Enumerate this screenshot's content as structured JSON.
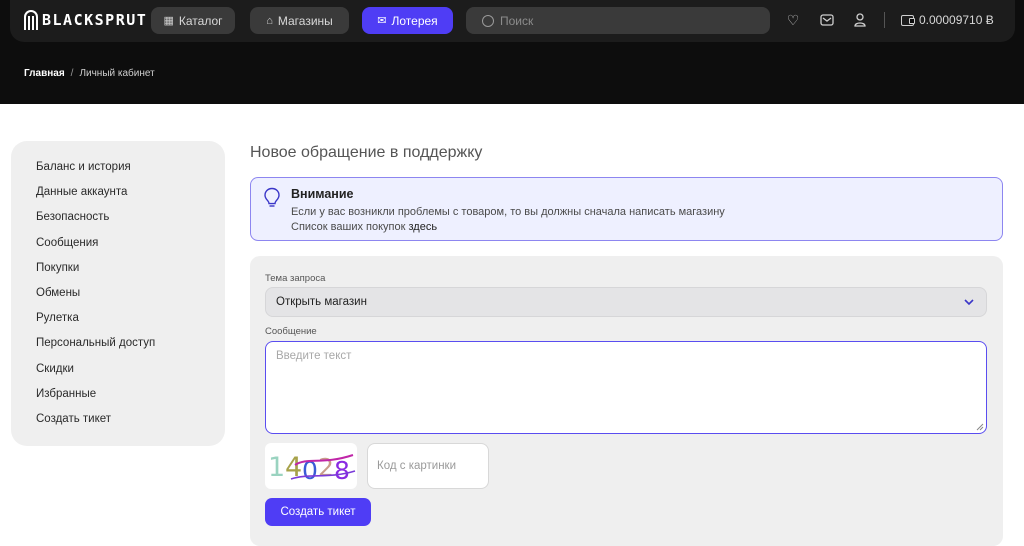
{
  "header": {
    "logo_text": "BLACKSPRUT",
    "nav": [
      {
        "label": "Каталог",
        "icon": "grid-icon"
      },
      {
        "label": "Магазины",
        "icon": "store-icon"
      },
      {
        "label": "Лотерея",
        "icon": "ticket-icon",
        "active": true
      }
    ],
    "search_placeholder": "Поиск",
    "balance": "0.00009710 Ƀ",
    "icons": [
      "heart-icon",
      "mail-icon",
      "user-icon",
      "wallet-icon"
    ]
  },
  "breadcrumb": {
    "home": "Главная",
    "separator": "/",
    "current": "Личный кабинет"
  },
  "sidebar": {
    "items": [
      {
        "label": "Баланс и история"
      },
      {
        "label": "Данные аккаунта"
      },
      {
        "label": "Безопасность"
      },
      {
        "label": "Сообщения"
      },
      {
        "label": "Покупки"
      },
      {
        "label": "Обмены"
      },
      {
        "label": "Рулетка"
      },
      {
        "label": "Персональный доступ"
      },
      {
        "label": "Скидки"
      },
      {
        "label": "Избранные"
      },
      {
        "label": "Создать тикет"
      }
    ]
  },
  "main": {
    "title": "Новое обращение в поддержку",
    "alert": {
      "title": "Внимание",
      "line1": "Если у вас возникли проблемы с товаром, то вы должны сначала написать магазину",
      "line2_prefix": "Список ваших покупок",
      "line2_link": "здесь"
    },
    "form": {
      "topic_label": "Тема запроса",
      "topic_value": "Открыть магазин",
      "message_label": "Сообщение",
      "message_placeholder": "Введите текст",
      "captcha_text": "14028",
      "captcha_input_placeholder": "Код с картинки",
      "submit_label": "Создать тикет"
    }
  },
  "colors": {
    "accent": "#4f3df5",
    "header_bg": "#0d0d0d",
    "alert_bg": "#eef0ff",
    "alert_border": "#8d86f0",
    "panel_bg": "#efefef"
  }
}
